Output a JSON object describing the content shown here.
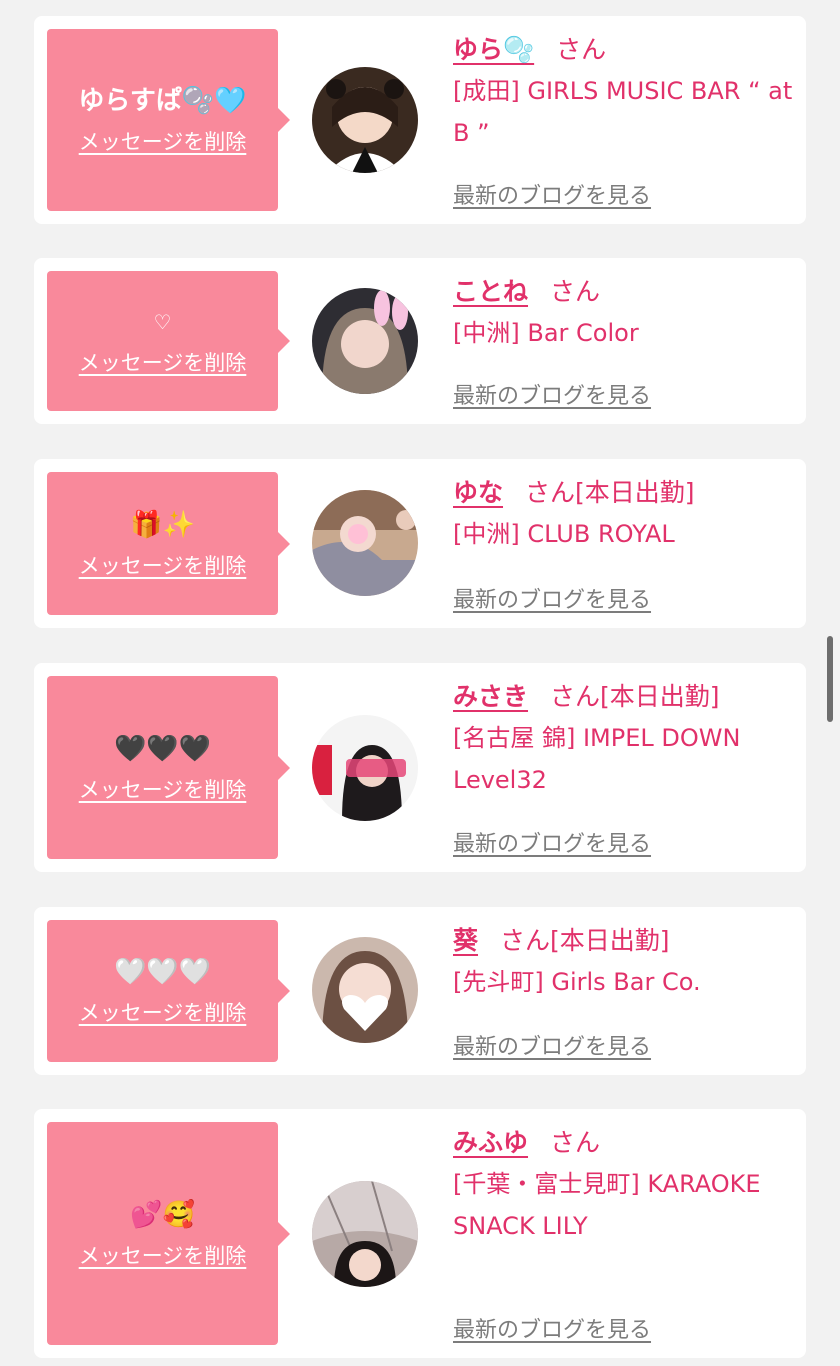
{
  "common": {
    "san": "さん",
    "delete_label": "メッセージを削除",
    "blog_label": "最新のブログを見る"
  },
  "items": [
    {
      "message": "ゆらすぱ🫧🩵",
      "name": "ゆら🫧",
      "status": "",
      "shop": "[成田] GIRLS MUSIC BAR “ at B ”"
    },
    {
      "message": "♡",
      "name": "ことね",
      "status": "",
      "shop": "[中洲] Bar Color"
    },
    {
      "message": "🎁✨",
      "name": "ゆな",
      "status": "[本日出勤]",
      "shop": "[中洲] CLUB ROYAL"
    },
    {
      "message": "🖤🖤🖤",
      "name": "みさき",
      "status": "[本日出勤]",
      "shop": "[名古屋 錦] IMPEL DOWN Level32"
    },
    {
      "message": "🤍🤍🤍",
      "name": "葵",
      "status": "[本日出勤]",
      "shop": "[先斗町] Girls Bar Co."
    },
    {
      "message": "💕🥰",
      "name": "みふゆ",
      "status": "",
      "shop": "[千葉・富士見町] KARAOKE SNACK LILY"
    }
  ],
  "colors": {
    "accent": "#e1316a",
    "bubble": "#f9899b",
    "background": "#f2f2f2",
    "link_gray": "#7c7c7c"
  }
}
